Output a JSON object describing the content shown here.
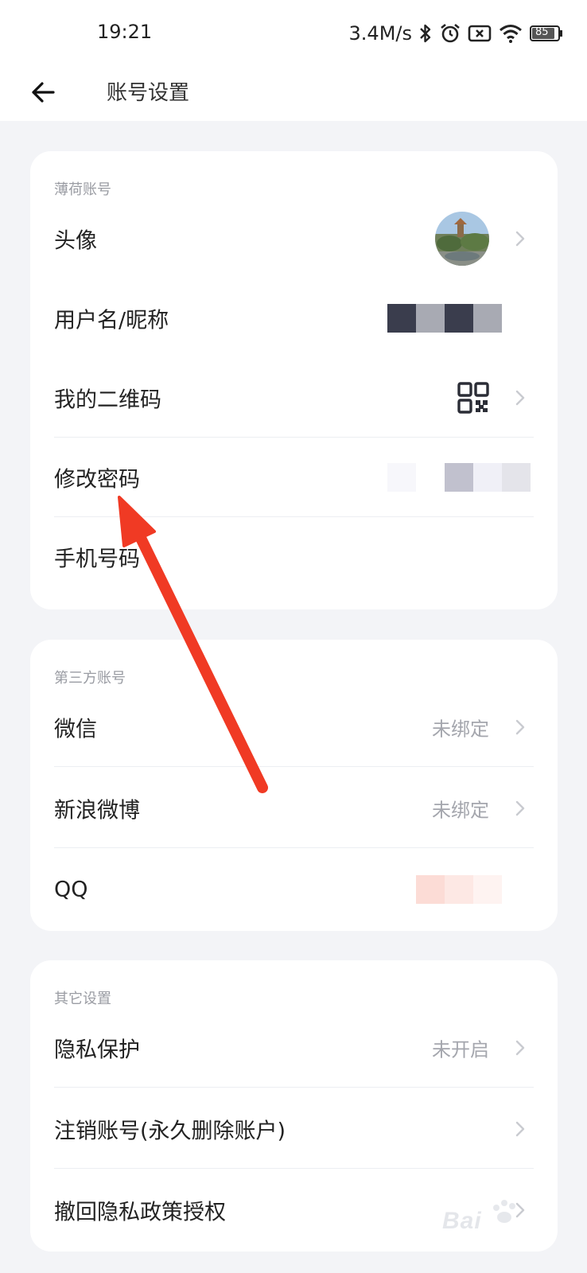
{
  "status_bar": {
    "time": "19:21",
    "net_speed": "3.4M/s",
    "battery": "85"
  },
  "header": {
    "title": "账号设置"
  },
  "sections": {
    "mint": {
      "label": "薄荷账号",
      "rows": {
        "avatar": "头像",
        "username": "用户名/昵称",
        "qrcode": "我的二维码",
        "password": "修改密码",
        "phone": "手机号码"
      }
    },
    "third_party": {
      "label": "第三方账号",
      "rows": {
        "wechat": {
          "label": "微信",
          "value": "未绑定"
        },
        "weibo": {
          "label": "新浪微博",
          "value": "未绑定"
        },
        "qq": {
          "label": "QQ"
        }
      }
    },
    "other": {
      "label": "其它设置",
      "rows": {
        "privacy": {
          "label": "隐私保护",
          "value": "未开启"
        },
        "delete_account": {
          "label": "注销账号(永久删除账户)"
        },
        "revoke_privacy": {
          "label": "撤回隐私政策授权"
        }
      }
    }
  },
  "colors": {
    "accent_arrow": "#f03a24",
    "background": "#f3f4f7",
    "card": "#ffffff"
  },
  "watermark": {
    "text": "Bai"
  }
}
